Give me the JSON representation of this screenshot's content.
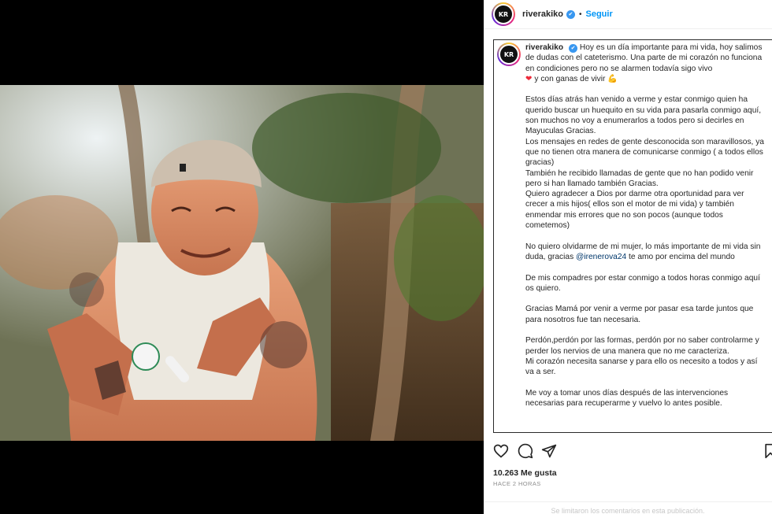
{
  "profile": {
    "username": "riverakiko",
    "avatar_initials": "KR",
    "verified_icon": "✔",
    "separator": "•",
    "follow_label": "Seguir"
  },
  "caption": {
    "username": "riverakiko",
    "p1": "Hoy es un día importante para mi vida, hoy salimos de dudas con el cateterismo. Una parte de mi corazón no funciona en condiciones pero no se alarmen todavía sigo vivo",
    "p1_heart": "❤",
    "p1_end": "y con ganas de vivir",
    "p1_emoji": "💪",
    "p2": "Estos días atrás han venido a verme y estar conmigo quien ha querido buscar un huequito en su vida para pasarla conmigo aquí, son muchos no voy a enumerarlos a todos pero si decirles en Mayuculas Gracias.",
    "p3": "Los mensajes en redes de gente desconocida son maravillosos, ya que no tienen otra manera de comunicarse conmigo ( a todos ellos gracias)",
    "p4": "También he recibido llamadas de gente que no han podido venir pero si han llamado también Gracias.",
    "p5": "Quiero agradecer a Dios por darme otra oportunidad para ver crecer a mis hijos( ellos son el motor de mi vida) y también enmendar mis errores que no son pocos (aunque todos cometemos)",
    "p6_start": "No quiero olvidarme de mi mujer, lo más importante de mi vida sin duda, gracias",
    "p6_mention": "@irenerova24",
    "p6_end": "te amo por encima del mundo",
    "p7": "De mis compadres por estar conmigo a todos horas conmigo aquí os quiero.",
    "p8": "Gracias Mamá por venir a verme por pasar esa tarde juntos que para nosotros fue tan necesaria.",
    "p9": "Perdón,perdón por las formas, perdón por no saber controlarme y perder los nervios de una manera que no me caracteriza.",
    "p10": "Mi corazón necesita sanarse y para ello os necesito a todos y así va a ser.",
    "p11": "Me voy a tomar unos días después de las intervenciones necesarias para recuperarme y vuelvo lo antes posible."
  },
  "actions": {
    "like_icon": "heart-outline-icon",
    "comment_icon": "comment-bubble-icon",
    "share_icon": "paper-plane-icon",
    "save_icon": "bookmark-icon"
  },
  "stats": {
    "likes": "10.263 Me gusta",
    "time_ago": "HACE 2 HORAS"
  },
  "footer": {
    "comments_limited": "Se limitaron los comentarios en esta publicación."
  },
  "colors": {
    "accent": "#0095f6",
    "verified": "#3897f0",
    "mention": "#00376b",
    "heart": "#ed2939"
  }
}
